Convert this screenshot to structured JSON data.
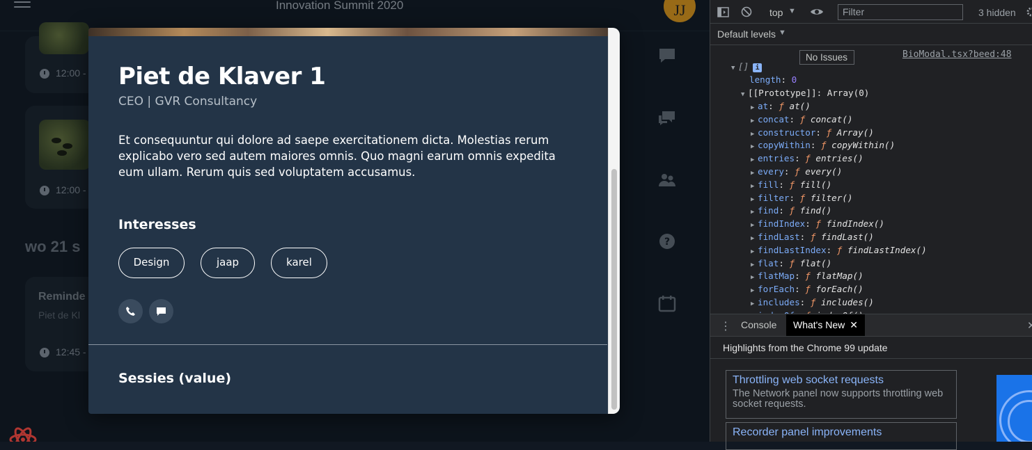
{
  "app": {
    "title": "Innovation Summit 2020",
    "avatar_initials": "JJ",
    "session_cards": [
      {
        "time": "12:00 -"
      },
      {
        "time": "12:00 -"
      }
    ],
    "day_heading": "wo 21 s",
    "reminder": {
      "title": "Reminde",
      "subtitle": "Piet de Kl",
      "time": "12:45 -"
    },
    "side_icons": [
      "chat-icon",
      "chats-icon",
      "people-icon",
      "help-icon",
      "calendar-icon"
    ]
  },
  "modal": {
    "name": "Piet de Klaver 1",
    "role": "CEO | GVR Consultancy",
    "bio": "Et consequuntur qui dolore ad saepe exercitationem dicta. Molestias rerum explicabo vero sed autem maiores omnis. Quo magni earum omnis expedita eum ullam. Rerum quis sed voluptatem accusamus.",
    "interests_label": "Interesses",
    "interests": [
      "Design",
      "jaap",
      "karel"
    ],
    "contact_icons": [
      "phone-icon",
      "message-icon"
    ],
    "sessions_label": "Sessies (value)"
  },
  "devtools": {
    "context": "top",
    "filter_placeholder": "Filter",
    "hidden_count": "3 hidden",
    "levels": "Default levels",
    "issues": "No Issues",
    "source_link": "BioModal.tsx?beed:48",
    "array_label": "[]",
    "length_key": "length",
    "length_value": "0",
    "prototype_label": "[[Prototype]]: Array(0)",
    "methods": [
      {
        "key": "at",
        "fn": "at()"
      },
      {
        "key": "concat",
        "fn": "concat()"
      },
      {
        "key": "constructor",
        "fn": "Array()"
      },
      {
        "key": "copyWithin",
        "fn": "copyWithin()"
      },
      {
        "key": "entries",
        "fn": "entries()"
      },
      {
        "key": "every",
        "fn": "every()"
      },
      {
        "key": "fill",
        "fn": "fill()"
      },
      {
        "key": "filter",
        "fn": "filter()"
      },
      {
        "key": "find",
        "fn": "find()"
      },
      {
        "key": "findIndex",
        "fn": "findIndex()"
      },
      {
        "key": "findLast",
        "fn": "findLast()"
      },
      {
        "key": "findLastIndex",
        "fn": "findLastIndex()"
      },
      {
        "key": "flat",
        "fn": "flat()"
      },
      {
        "key": "flatMap",
        "fn": "flatMap()"
      },
      {
        "key": "forEach",
        "fn": "forEach()"
      },
      {
        "key": "includes",
        "fn": "includes()"
      },
      {
        "key": "indexOf",
        "fn": "indexOf()"
      }
    ],
    "drawer_tabs": [
      "Console",
      "What's New"
    ],
    "highlights": "Highlights from the Chrome 99 update",
    "features": [
      {
        "title": "Throttling web socket requests",
        "desc": "The Network panel now supports throttling web socket requests."
      },
      {
        "title": "Recorder panel improvements",
        "desc": ""
      }
    ]
  },
  "colors": {
    "modal_bg": "#233447",
    "page_bg": "#0f1720",
    "devtools_bg": "#202124",
    "link_blue": "#8ab4f8"
  }
}
